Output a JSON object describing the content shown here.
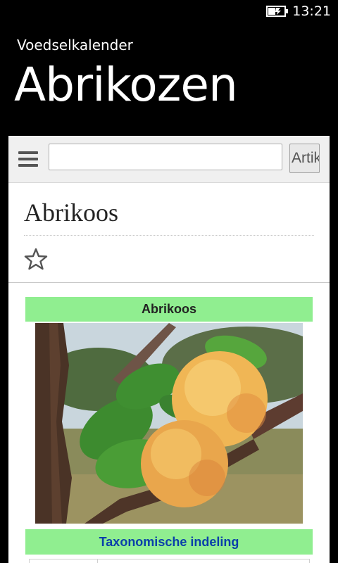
{
  "status_bar": {
    "time": "13:21",
    "battery_icon": "battery-charging-icon"
  },
  "app": {
    "name": "Voedselkalender",
    "title": "Abrikozen"
  },
  "browser": {
    "menu_icon": "hamburger-menu-icon",
    "search_value": "",
    "search_button_label": "Artikel"
  },
  "article": {
    "title": "Abrikoos",
    "watch_icon": "star-outline-icon",
    "infobox": {
      "title": "Abrikoos",
      "image_subject": "abrikoos-photo",
      "section": "Taxonomische indeling",
      "accent_color": "#90ee90",
      "link_color": "#0a3faa"
    }
  }
}
